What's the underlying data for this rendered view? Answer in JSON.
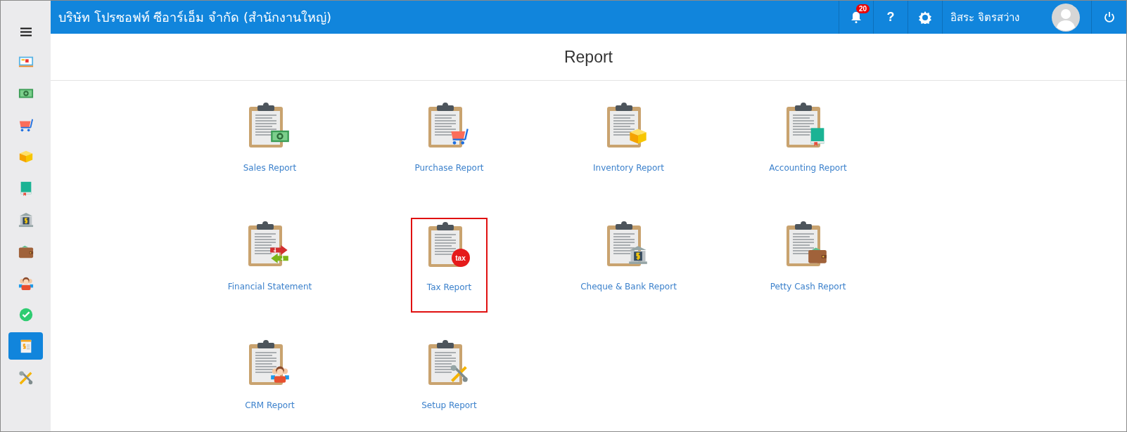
{
  "topbar": {
    "company": "บริษัท โปรซอฟท์ ซีอาร์เอ็ม จำกัด (สำนักงานใหญ่)",
    "notification_count": "20",
    "help": "?",
    "user_name": "อิสระ จิตรสว่าง"
  },
  "sidebar": {
    "items": [
      {
        "kind": "dashboard",
        "selected": false
      },
      {
        "kind": "money",
        "selected": false
      },
      {
        "kind": "cart",
        "selected": false
      },
      {
        "kind": "box",
        "selected": false
      },
      {
        "kind": "book",
        "selected": false
      },
      {
        "kind": "bank",
        "selected": false
      },
      {
        "kind": "wallet",
        "selected": false
      },
      {
        "kind": "people",
        "selected": false
      },
      {
        "kind": "check",
        "selected": false
      },
      {
        "kind": "report",
        "selected": true
      },
      {
        "kind": "tools",
        "selected": false
      }
    ]
  },
  "page": {
    "title": "Report"
  },
  "reports": [
    {
      "label": "Sales Report",
      "kind": "money",
      "selected": false
    },
    {
      "label": "Purchase Report",
      "kind": "cart",
      "selected": false
    },
    {
      "label": "Inventory Report",
      "kind": "box",
      "selected": false
    },
    {
      "label": "Accounting Report",
      "kind": "book",
      "selected": false
    },
    {
      "label": "Financial Statement",
      "kind": "transfer",
      "selected": false
    },
    {
      "label": "Tax Report",
      "kind": "tax",
      "badge": "tax",
      "selected": true
    },
    {
      "label": "Cheque & Bank Report",
      "kind": "bank",
      "selected": false
    },
    {
      "label": "Petty Cash Report",
      "kind": "wallet",
      "selected": false
    },
    {
      "label": "CRM Report",
      "kind": "people",
      "selected": false
    },
    {
      "label": "Setup Report",
      "kind": "tools",
      "selected": false
    }
  ]
}
